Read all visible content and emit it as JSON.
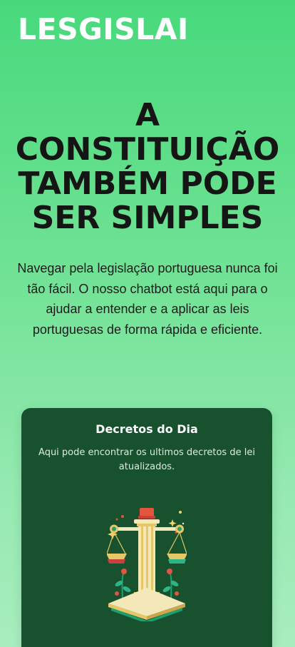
{
  "header": {
    "logo_text": "LESGISLAI"
  },
  "hero": {
    "title_line_1": "A",
    "title_line_2": "CONSTITUIÇÃO",
    "title_line_3": "TAMBÉM PODE",
    "title_line_4": "SER SIMPLES",
    "subtitle": "Navegar pela legislação portuguesa nunca foi tão fácil. O nosso chatbot está aqui para o ajudar a entender e a aplicar as leis portuguesas de forma rápida e eficiente."
  },
  "card": {
    "title": "Decretos do Dia",
    "description": "Aqui pode encontrar os ultimos decretos de lei atualizados.",
    "illustration": "scales-of-justice-icon"
  },
  "colors": {
    "gradient_top": "#48d97c",
    "gradient_bottom": "#a8edbf",
    "card_background": "#17512e",
    "logo": "#ffffff",
    "title": "#151515"
  }
}
